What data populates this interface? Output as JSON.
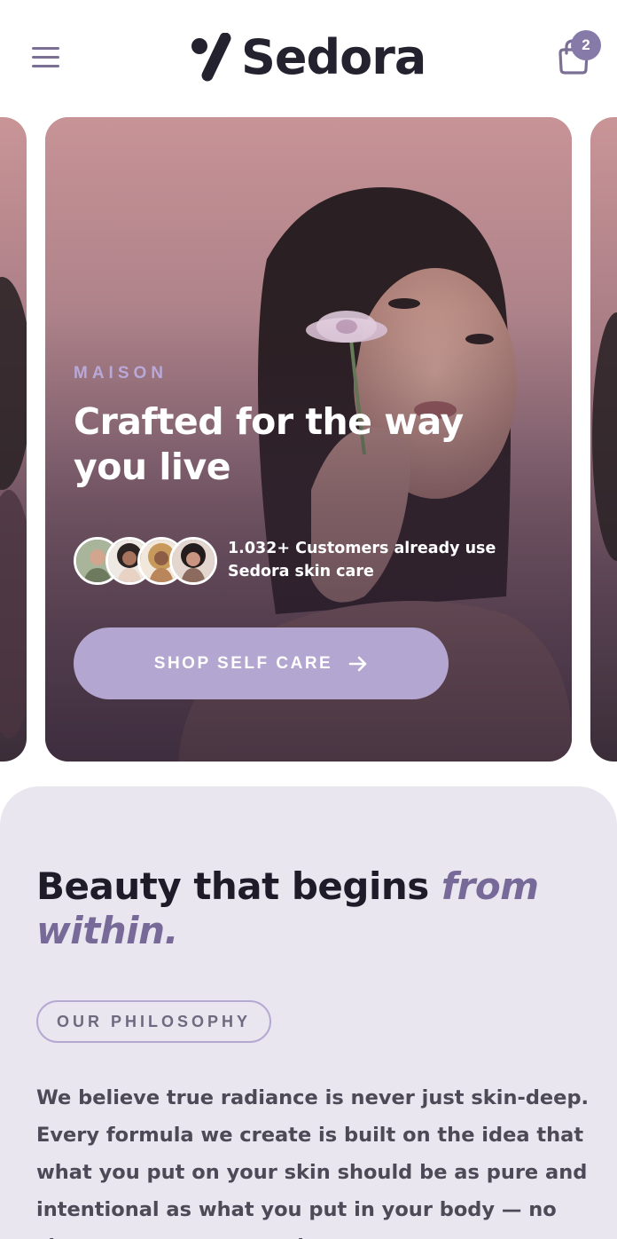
{
  "header": {
    "brand_name": "Sedora",
    "cart_count": "2",
    "menu_icon": "hamburger-menu-icon",
    "cart_icon": "shopping-bag-icon"
  },
  "hero": {
    "eyebrow": "MAISON",
    "title": "Crafted for the way you live",
    "social_proof": "1.032+ Customers already use Sedora skin care",
    "cta_label": "SHOP SELF CARE",
    "cta_icon": "arrow-right-icon"
  },
  "philosophy": {
    "title_main": "Beauty that begins ",
    "title_accent": "from within.",
    "tag": "OUR PHILOSOPHY",
    "body": "We believe true radiance is never just skin-deep. Every formula we create is built on the idea that what you put on your skin should be as pure and intentional as what you put in your body — no shortcuts, no compromise."
  },
  "colors": {
    "brand_dark": "#25222f",
    "accent_purple": "#867aa9",
    "cta_lavender": "#b3a6d0",
    "section_bg": "#e9e6ef",
    "eyebrow_lilac": "#b9a9d9"
  }
}
